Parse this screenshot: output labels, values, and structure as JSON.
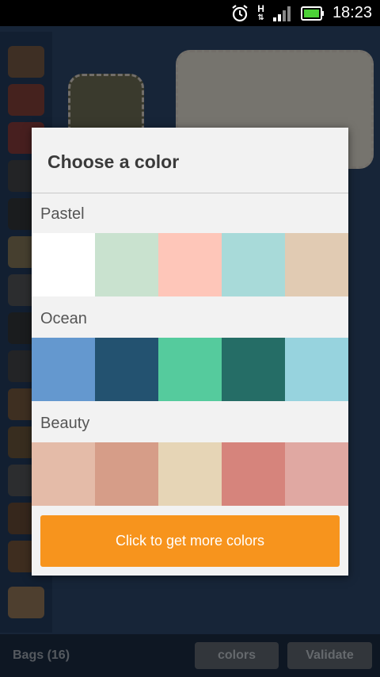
{
  "status_bar": {
    "time": "18:23",
    "data_indicator": "H"
  },
  "background": {
    "bag_count_title": "Bags (16)",
    "colors_button": "colors",
    "validate_button": "Validate"
  },
  "dialog": {
    "title": "Choose a color",
    "groups": [
      {
        "name": "Pastel",
        "colors": [
          "#ffffff",
          "#c9e2cf",
          "#fec6b9",
          "#a8dad9",
          "#e1cbb3"
        ]
      },
      {
        "name": "Ocean",
        "colors": [
          "#6498cf",
          "#235270",
          "#55cb9d",
          "#256d66",
          "#97d3de"
        ]
      },
      {
        "name": "Beauty",
        "colors": [
          "#e4bba8",
          "#d69d88",
          "#e6d5b6",
          "#d6847c",
          "#e0a8a2"
        ]
      }
    ],
    "more_colors_button": "Click to get more colors"
  },
  "colors": {
    "accent": "#f7941d",
    "dialog_bg": "#f2f2f2",
    "app_bg": "#2b4466"
  }
}
